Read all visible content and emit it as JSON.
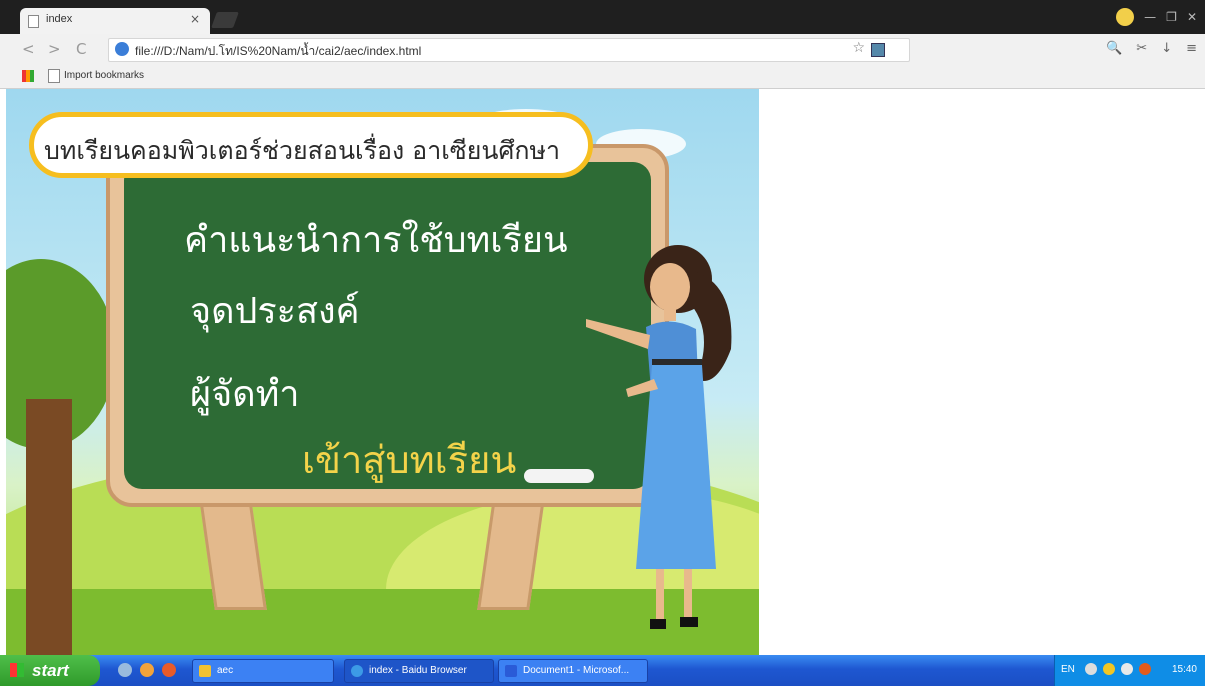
{
  "browser": {
    "tab_title": "index",
    "tab_close": "×",
    "address": "file:///D:/Nam/ป.โท/IS%20Nam/น้ำ/cai2/aec/index.html",
    "bookmark_label": "Import bookmarks",
    "star": "☆",
    "nav": {
      "back": "<",
      "forward": ">",
      "reload": "C"
    },
    "tools": [
      "🔍",
      "✂",
      "↓",
      "≡"
    ]
  },
  "page": {
    "headline": "บทเรียนคอมพิวเตอร์ช่วยสอนเรื่อง  อาเซียนศึกษา",
    "menu": {
      "instructions": "คำแนะนำการใช้บทเรียน",
      "objectives": "จุดประสงค์",
      "author": "ผู้จัดทำ",
      "enter": "เข้าสู่บทเรียน"
    }
  },
  "taskbar": {
    "start": "start",
    "tasks": [
      {
        "label": "aec",
        "color": "#f1c232"
      },
      {
        "label": "index - Baidu Browser",
        "color": "#3c9ae6"
      },
      {
        "label": "Document1 - Microsof...",
        "color": "#2a5bd7"
      }
    ],
    "language": "EN",
    "clock": "15:40"
  }
}
